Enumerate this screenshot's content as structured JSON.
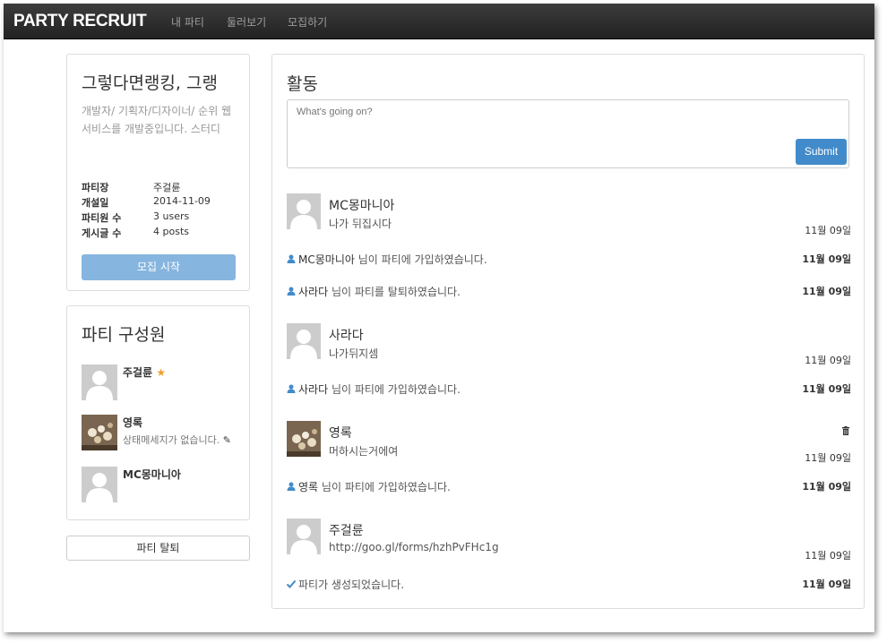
{
  "navbar": {
    "brand": "PARTY RECRUIT",
    "links": [
      "내 파티",
      "둘러보기",
      "모집하기"
    ]
  },
  "party": {
    "title": "그렇다면랭킹, 그랭",
    "description": "개발자/ 기획자/디자이너/ 순위 웹 서비스를 개발중입니다. 스터디",
    "info": [
      {
        "label": "파티장",
        "value": "주걸륜"
      },
      {
        "label": "개설일",
        "value": "2014-11-09"
      },
      {
        "label": "파티원 수",
        "value": "3 users"
      },
      {
        "label": "게시글 수",
        "value": "4 posts"
      }
    ],
    "recruit_button": "모집 시작"
  },
  "members": {
    "title": "파티 구성원",
    "list": [
      {
        "name": "주걸륜",
        "status": "",
        "leader": true,
        "avatar": "placeholder"
      },
      {
        "name": "영록",
        "status": "상태메세지가 없습니다.",
        "leader": false,
        "avatar": "photo"
      },
      {
        "name": "MC몽마니아",
        "status": "",
        "leader": false,
        "avatar": "placeholder"
      }
    ],
    "leave_button": "파티 탈퇴"
  },
  "activity": {
    "title": "활동",
    "input_placeholder": "What's going on?",
    "submit_label": "Submit",
    "feed": [
      {
        "type": "post",
        "author": "MC몽마니아",
        "content": "나가 뒤집시다",
        "date": "11월 09일",
        "avatar": "placeholder"
      },
      {
        "type": "event",
        "icon": "user-icon",
        "name": "MC몽마니아",
        "text": "님이 파티에 가입하였습니다.",
        "date": "11월 09일"
      },
      {
        "type": "event",
        "icon": "user-icon",
        "name": "사라다",
        "text": "님이 파티를 탈퇴하였습니다.",
        "date": "11월 09일"
      },
      {
        "type": "post",
        "author": "사라다",
        "content": "나가뒤지셈",
        "date": "11월 09일",
        "avatar": "placeholder"
      },
      {
        "type": "event",
        "icon": "user-icon",
        "name": "사라다",
        "text": "님이 파티에 가입하였습니다.",
        "date": "11월 09일"
      },
      {
        "type": "post",
        "author": "영록",
        "content": "머하시는거에여",
        "date": "11월 09일",
        "avatar": "photo",
        "deletable": true
      },
      {
        "type": "event",
        "icon": "user-icon",
        "name": "영록",
        "text": "님이 파티에 가입하였습니다.",
        "date": "11월 09일"
      },
      {
        "type": "post",
        "author": "주걸륜",
        "content": "http://goo.gl/forms/hzhPvFHc1g",
        "date": "11월 09일",
        "avatar": "placeholder"
      },
      {
        "type": "event",
        "icon": "check-icon",
        "name": "",
        "text": "파티가 생성되었습니다.",
        "date": "11월 09일"
      }
    ]
  },
  "colors": {
    "navbar_bg": "#222222",
    "primary": "#428bca",
    "recruit_btn": "#86b5df",
    "leader_star": "#f0a030"
  }
}
